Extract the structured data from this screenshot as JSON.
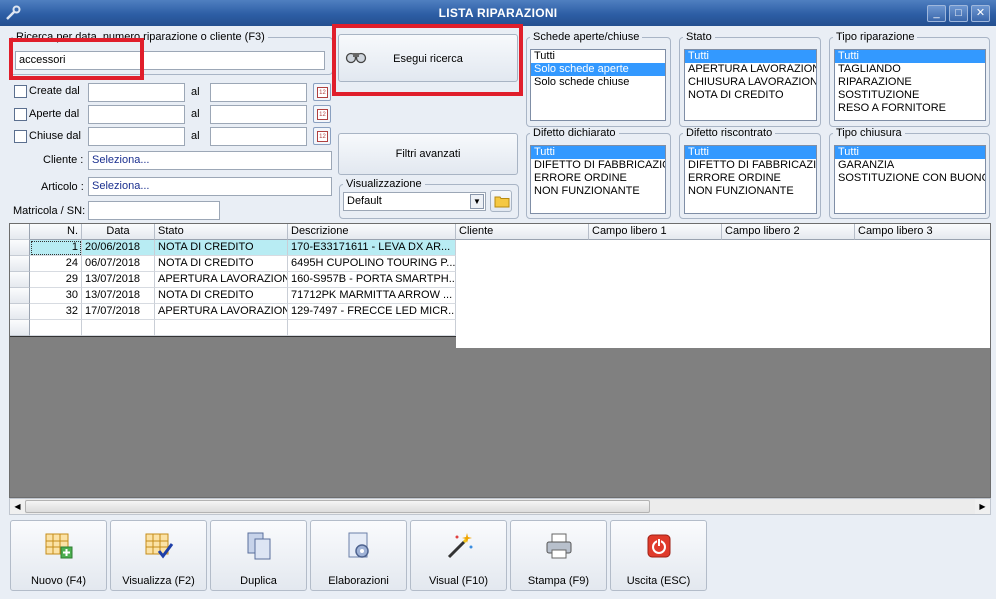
{
  "window": {
    "title": "LISTA RIPARAZIONI",
    "buttons": [
      "_",
      "□",
      "✕"
    ]
  },
  "search": {
    "legend": "Ricerca per data, numero riparazione o cliente (F3)",
    "value": "accessori",
    "button_label": "Esegui ricerca"
  },
  "dates": [
    {
      "label": "Create dal",
      "to_label": "al"
    },
    {
      "label": "Aperte dal",
      "to_label": "al"
    },
    {
      "label": "Chiuse dal",
      "to_label": "al"
    }
  ],
  "calendar_icon_text": "12",
  "cliente": {
    "label": "Cliente :",
    "value": "Seleziona..."
  },
  "articolo": {
    "label": "Articolo :",
    "value": "Seleziona..."
  },
  "matricola": {
    "label": "Matricola / SN:",
    "value": ""
  },
  "filtri_avanzati_label": "Filtri avanzati",
  "visualizzazione": {
    "legend": "Visualizzazione",
    "selected": "Default"
  },
  "schede": {
    "legend": "Schede aperte/chiuse",
    "items": [
      "Tutti",
      "Solo schede aperte",
      "Solo schede chiuse"
    ],
    "selected_index": 1
  },
  "stato": {
    "legend": "Stato",
    "items": [
      "Tutti",
      "APERTURA LAVORAZIONE",
      "CHIUSURA LAVORAZIONE",
      "NOTA DI CREDITO"
    ],
    "selected_index": 0
  },
  "tipo_riparazione": {
    "legend": "Tipo riparazione",
    "items": [
      "Tutti",
      "TAGLIANDO",
      "RIPARAZIONE",
      "SOSTITUZIONE",
      "RESO A FORNITORE"
    ],
    "selected_index": 0
  },
  "difetto_dichiarato": {
    "legend": "Difetto dichiarato",
    "items": [
      "Tutti",
      "DIFETTO DI FABBRICAZIO",
      "ERRORE ORDINE",
      "NON FUNZIONANTE"
    ],
    "selected_index": 0
  },
  "difetto_riscontrato": {
    "legend": "Difetto riscontrato",
    "items": [
      "Tutti",
      "DIFETTO DI FABBRICAZIO",
      "ERRORE ORDINE",
      "NON FUNZIONANTE"
    ],
    "selected_index": 0
  },
  "tipo_chiusura": {
    "legend": "Tipo chiusura",
    "items": [
      "Tutti",
      "GARANZIA",
      "SOSTITUZIONE CON BUONO A"
    ],
    "selected_index": 0
  },
  "grid": {
    "columns": [
      "N.",
      "Data",
      "Stato",
      "Descrizione",
      "Cliente",
      "Campo libero 1",
      "Campo libero 2",
      "Campo libero 3"
    ],
    "rows": [
      [
        "1",
        "20/06/2018",
        "NOTA DI CREDITO",
        "170-E33171611 - LEVA  DX AR..."
      ],
      [
        "24",
        "06/07/2018",
        "NOTA DI CREDITO",
        "6495H CUPOLINO TOURING P..."
      ],
      [
        "29",
        "13/07/2018",
        "APERTURA LAVORAZIONE",
        "160-S957B - PORTA SMARTPH..."
      ],
      [
        "30",
        "13/07/2018",
        "NOTA DI CREDITO",
        "71712PK MARMITTA ARROW ..."
      ],
      [
        "32",
        "17/07/2018",
        "APERTURA LAVORAZIONE",
        "129-7497 - FRECCE LED MICR..."
      ]
    ]
  },
  "toolbar": [
    {
      "label": "Nuovo (F4)",
      "icon": "grid-add-icon"
    },
    {
      "label": "Visualizza (F2)",
      "icon": "grid-check-icon"
    },
    {
      "label": "Duplica",
      "icon": "duplicate-icon"
    },
    {
      "label": "Elaborazioni",
      "icon": "gear-document-icon"
    },
    {
      "label": "Visual (F10)",
      "icon": "magic-wand-icon"
    },
    {
      "label": "Stampa (F9)",
      "icon": "printer-icon"
    },
    {
      "label": "Uscita (ESC)",
      "icon": "power-icon"
    }
  ]
}
